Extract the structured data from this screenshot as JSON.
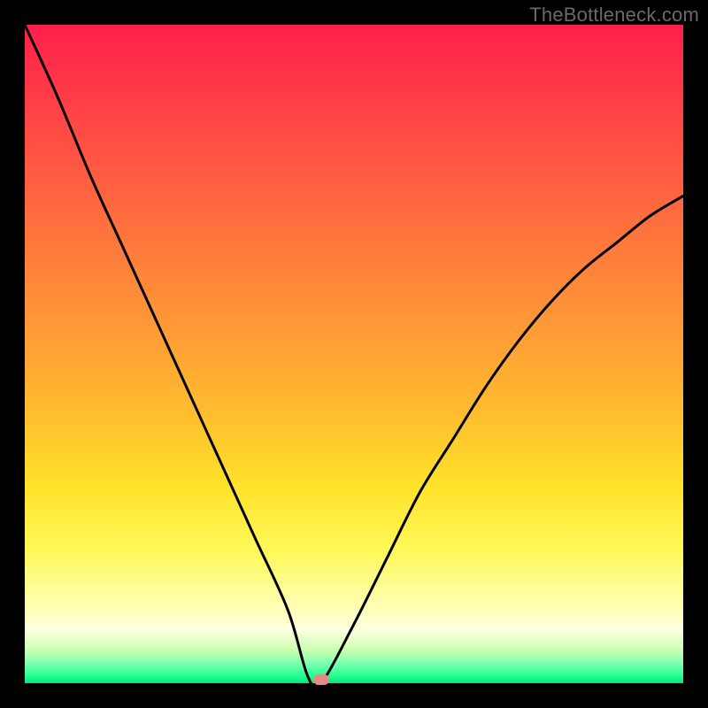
{
  "watermark": "TheBottleneck.com",
  "colors": {
    "frame": "#000000",
    "curve": "#000000",
    "marker": "#e58b86"
  },
  "chart_data": {
    "type": "line",
    "title": "",
    "xlabel": "",
    "ylabel": "",
    "xlim": [
      0,
      100
    ],
    "ylim": [
      0,
      100
    ],
    "grid": false,
    "legend": false,
    "x": [
      0,
      5,
      10,
      15,
      20,
      25,
      30,
      35,
      40,
      43,
      45,
      50,
      55,
      60,
      65,
      70,
      75,
      80,
      85,
      90,
      95,
      100
    ],
    "values": [
      100,
      89,
      77,
      66,
      55,
      44,
      33,
      22,
      11,
      1,
      0,
      9,
      19,
      29,
      37,
      45,
      52,
      58,
      63,
      67,
      71,
      74
    ],
    "marker": {
      "x": 45,
      "y": 0
    },
    "note": "V-shaped bottleneck curve with minimum near x≈45. Y-values are approximate percentages read from the gradient; background encodes value via color (red=high, green=low)."
  }
}
